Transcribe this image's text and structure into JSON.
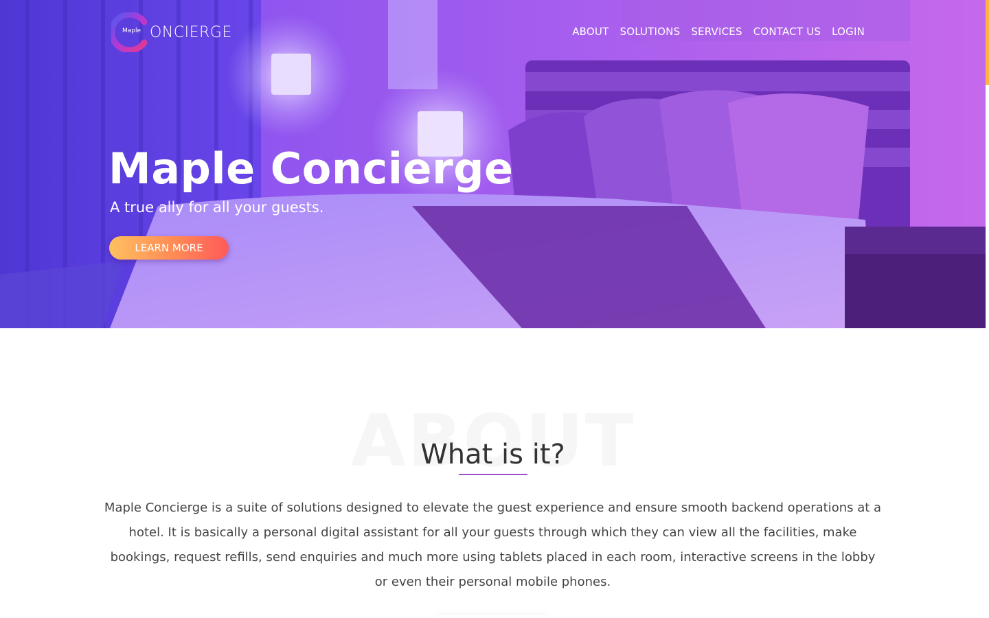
{
  "brand": {
    "logo_small": "Maple",
    "logo_word": "ONCIERGE"
  },
  "nav": {
    "items": [
      "ABOUT",
      "SOLUTIONS",
      "SERVICES",
      "CONTACT US",
      "LOGIN"
    ]
  },
  "hero": {
    "title": "Maple Concierge",
    "subtitle": "A true ally for all your guests.",
    "cta_label": "LEARN MORE"
  },
  "about": {
    "background_word": "ABOUT",
    "heading": "What is it?",
    "body": "Maple Concierge is a suite of solutions designed to elevate the guest experience and ensure smooth backend operations at a hotel. It is basically a personal digital assistant for all your guests through which they can view all the facilities, make bookings, request refills, send enquiries and much more using tablets placed in each room, interactive screens in the lobby or even their personal mobile phones."
  },
  "colors": {
    "hero_gradient_start": "#5a3fe0",
    "hero_gradient_end": "#b449e0",
    "cta_start": "#ffc061",
    "cta_end": "#ff5a5a",
    "accent_underline": "#9b4fd0",
    "scroll_thumb": "#ffb347"
  },
  "icons": {
    "logo": "maple-c-logo-icon"
  }
}
